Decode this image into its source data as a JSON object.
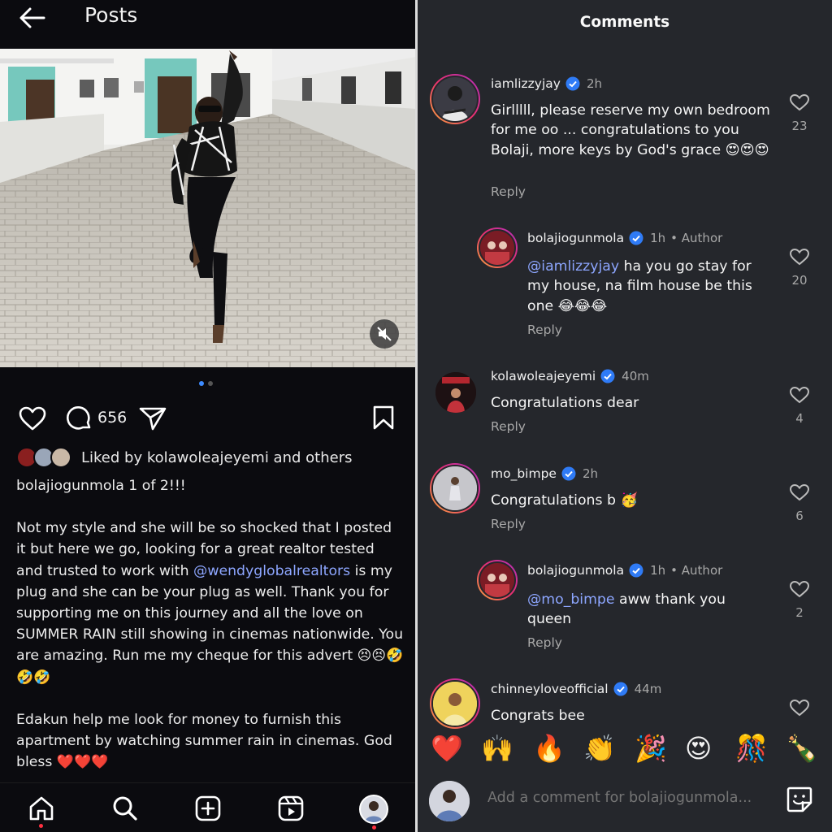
{
  "post": {
    "header_title": "Posts",
    "comment_count": "656",
    "liked_by": "Liked by kolawoleajeyemi and others",
    "caption_line1": "bolajiogunmola 1 of 2!!!",
    "caption_p1_a": "Not my style and she will be so shocked that I posted it but here we go, looking for a great realtor tested and trusted to work with ",
    "caption_mention": "@wendyglobalrealtors",
    "caption_p1_b": " is my plug and she can be your plug as well. Thank you for supporting me on this journey and all the love  on  SUMMER RAIN still showing in  cinemas nationwide. You are amazing. Run me my cheque for this advert ",
    "caption_p1_emoji": "😣😣🤣🤣🤣",
    "caption_p2": "Edakun help me look for money to furnish this apartment by watching summer rain in cinemas. God bless ",
    "caption_p2_emoji": "❤️❤️❤️",
    "carousel_index": 1,
    "carousel_total": 2
  },
  "comments_panel": {
    "title": "Comments",
    "comments": [
      {
        "user": "iamlizzyjay",
        "time": "2h",
        "text": "Girlllll, please reserve my own bedroom for me oo ... congratulations to you Bolaji, more keys by God's grace 😍😍😍",
        "reply": "Reply",
        "likes": "23"
      },
      {
        "user": "bolajiogunmola",
        "time": "1h",
        "author": "• Author",
        "mention": "@iamlizzyjay",
        "text": " ha you go stay for my house, na film house be this one 😂😂😂",
        "reply": "Reply",
        "likes": "20"
      },
      {
        "user": "kolawoleajeyemi",
        "time": "40m",
        "text": "Congratulations dear",
        "reply": "Reply",
        "likes": "4"
      },
      {
        "user": "mo_bimpe",
        "time": "2h",
        "text": "Congratulations b 🥳",
        "reply": "Reply",
        "likes": "6"
      },
      {
        "user": "bolajiogunmola",
        "time": "1h",
        "author": "• Author",
        "mention": "@mo_bimpe",
        "text": " aww thank you queen",
        "reply": "Reply",
        "likes": "2"
      },
      {
        "user": "chinneyloveofficial",
        "time": "44m",
        "text": "Congrats bee",
        "likes": ""
      }
    ],
    "reactions": [
      "❤️",
      "🙌",
      "🔥",
      "👏",
      "🎉",
      "😍",
      "🎊",
      "🍾"
    ],
    "add_comment_placeholder": "Add a comment for bolajiogunmola..."
  },
  "colors": {
    "mention": "#8da6ff",
    "accent": "#3d8bff",
    "verified": "#2f7bf6",
    "notification": "#ff3040"
  }
}
